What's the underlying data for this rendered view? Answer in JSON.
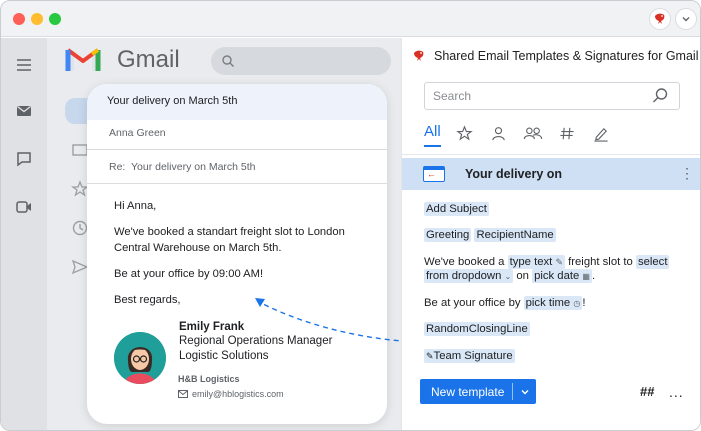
{
  "window": {
    "controls": [
      "close",
      "minimize",
      "maximize"
    ]
  },
  "gmail": {
    "brand": "Gmail",
    "email": {
      "subject": "Your delivery on March 5th",
      "to": "Anna Green",
      "re_prefix": "Re:",
      "re_subject": "Your delivery on March 5th",
      "body": {
        "greeting": "Hi Anna,",
        "line1": "We've booked a standart freight slot to London Central Warehouse on March 5th.",
        "line2": "Be at your office by 09:00 AM!",
        "closing": "Best regards,"
      },
      "signature": {
        "name": "Emily Frank",
        "role": "Regional Operations Manager",
        "department": "Logistic Solutions",
        "brand": "H&B Logistics",
        "email": "emily@hblogistics.com"
      }
    }
  },
  "panel": {
    "title": "Shared Email Templates & Signatures for Gmail",
    "search": {
      "placeholder": "Search",
      "value": ""
    },
    "tabs": {
      "all_label": "All",
      "icons": [
        "star-icon",
        "person-icon",
        "people-icon",
        "hashtag-icon",
        "pen-icon"
      ]
    },
    "template": {
      "name": "Your delivery on",
      "add_subject": "Add Subject",
      "greeting": "Greeting",
      "recipient": "RecipientName",
      "line_prefix": "We've booked a",
      "type_text": "type text",
      "line_mid": "freight slot to",
      "select_from_dropdown_1": "select",
      "select_from_dropdown_2": "from dropdown",
      "on_word": "on",
      "pick_date": "pick date",
      "period": ".",
      "office_prefix": "Be at your office by",
      "pick_time": "pick time",
      "exclaim": "!",
      "closing": "RandomClosingLine",
      "signature": "Team Signature"
    },
    "footer": {
      "new_template": "New template",
      "hashtag": "##",
      "more": "..."
    }
  },
  "colors": {
    "accent": "#1a73e8",
    "chip": "#d9e7f7",
    "selected_row": "#cfe0f4",
    "brand_red": "#d93025"
  }
}
